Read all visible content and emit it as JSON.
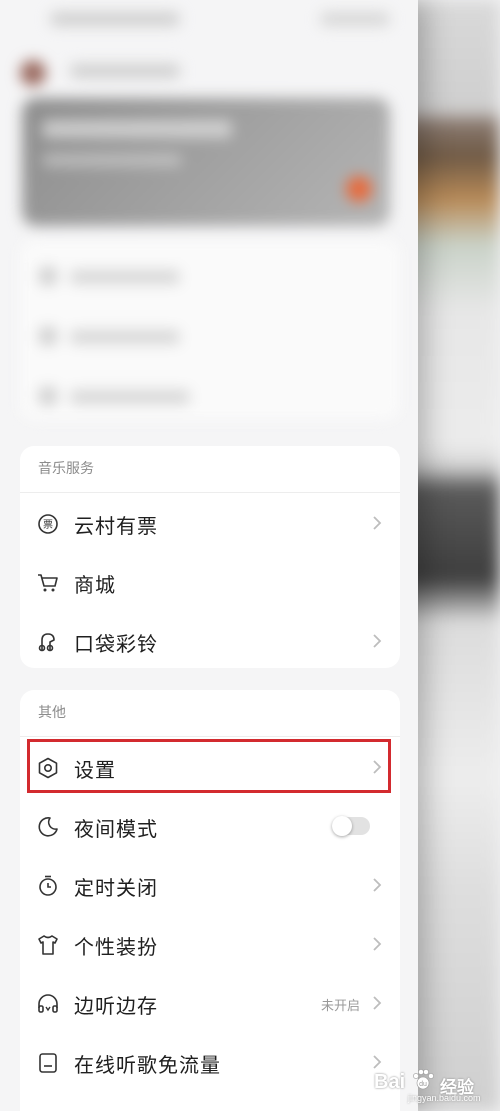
{
  "music_services": {
    "title": "音乐服务",
    "items": [
      {
        "label": "云村有票",
        "icon": "ticket-icon",
        "chevron": true
      },
      {
        "label": "商城",
        "icon": "cart-icon",
        "chevron": false
      },
      {
        "label": "口袋彩铃",
        "icon": "ringtone-icon",
        "chevron": true
      }
    ]
  },
  "other": {
    "title": "其他",
    "items": [
      {
        "label": "设置",
        "icon": "settings-icon",
        "chevron": true,
        "highlighted": true
      },
      {
        "label": "夜间模式",
        "icon": "moon-icon",
        "toggle": false
      },
      {
        "label": "定时关闭",
        "icon": "timer-icon",
        "chevron": true
      },
      {
        "label": "个性装扮",
        "icon": "tshirt-icon",
        "chevron": true
      },
      {
        "label": "边听边存",
        "icon": "headphones-icon",
        "chevron": true,
        "status": "未开启"
      },
      {
        "label": "在线听歌免流量",
        "icon": "sim-card-icon",
        "chevron": true
      }
    ]
  },
  "watermark": {
    "brand": "Bai",
    "suffix": "经验",
    "url": "jingyan.baidu.com"
  },
  "colors": {
    "highlight": "#d32a2f",
    "card_bg": "#ffffff",
    "drawer_bg": "#f5f5f6"
  }
}
